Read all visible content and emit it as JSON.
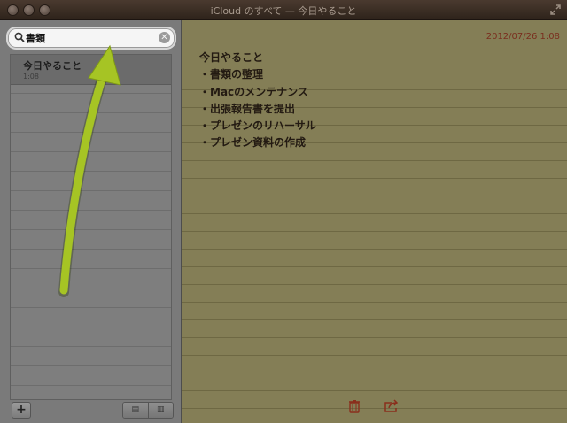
{
  "window": {
    "title": "iCloud のすべて — 今日やること"
  },
  "search": {
    "value": "書類",
    "clear_symbol": "✕"
  },
  "note_list": [
    {
      "title": "今日やること",
      "time": "1:08"
    }
  ],
  "sidebar_footer": {
    "add_label": "+",
    "view_list_label": "▤",
    "view_grid_label": "▥"
  },
  "note": {
    "date": "2012/07/26 1:08",
    "lines": [
      "今日やること",
      "・書類の整理",
      "・Macのメンテナンス",
      "・出張報告書を提出",
      "・プレゼンのリハーサル",
      "・プレゼン資料の作成"
    ]
  },
  "icons": {
    "search": "search-icon",
    "clear": "clear-search-icon",
    "trash": "trash-icon",
    "share": "share-icon",
    "fullscreen": "fullscreen-icon"
  },
  "colors": {
    "annotation_arrow": "#a6c424",
    "note_date": "#7a2e1e"
  }
}
